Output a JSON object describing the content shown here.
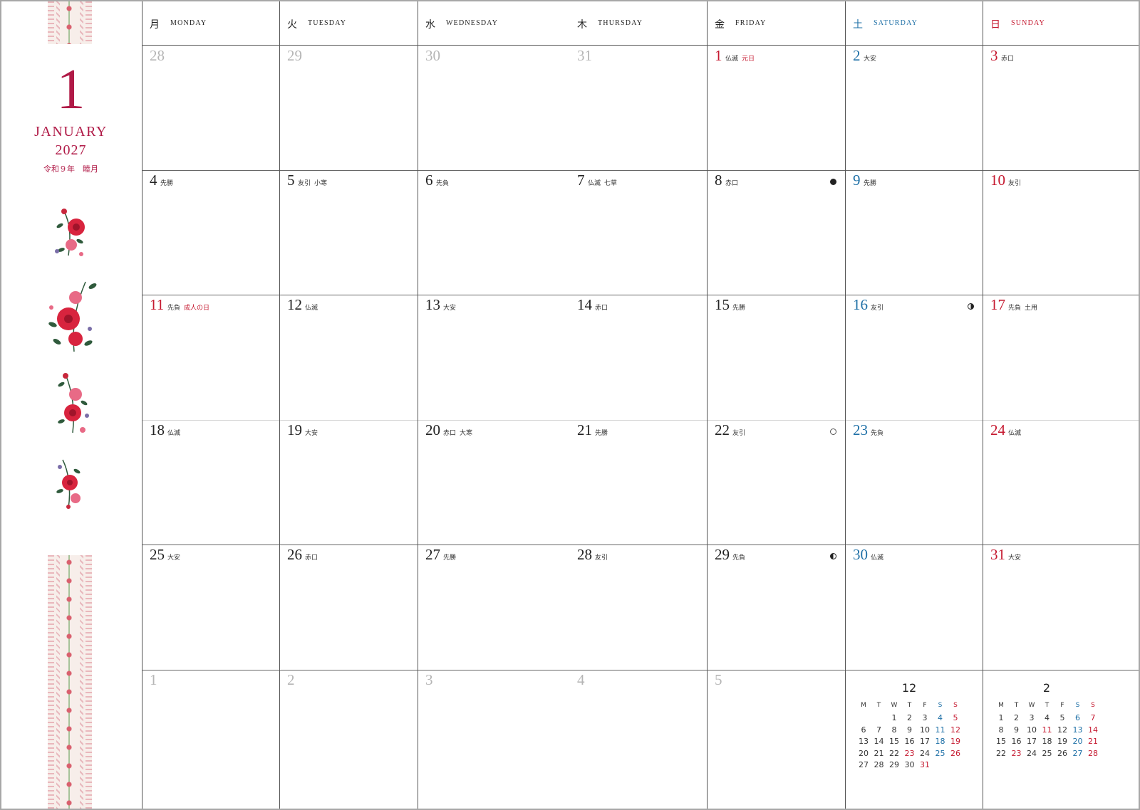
{
  "month": {
    "number": "1",
    "name": "JANUARY",
    "year": "2027",
    "era": "令和９年　睦月"
  },
  "sidebar": {
    "top_ribbon": "ribbon-decoration",
    "flowers": [
      "red-flower-sprig",
      "red-flower-sprig",
      "red-flower-sprig",
      "red-flower-sprig"
    ],
    "bottom_ribbon": "ribbon-decoration"
  },
  "colors": {
    "accent": "#b01a47",
    "saturday": "#1d6fa6",
    "sunday": "#c5182f",
    "muted": "#b5b5b5"
  },
  "headers": [
    {
      "kanji": "月",
      "eng": "MONDAY",
      "type": "weekday"
    },
    {
      "kanji": "火",
      "eng": "TUESDAY",
      "type": "weekday"
    },
    {
      "kanji": "水",
      "eng": "WEDNESDAY",
      "type": "weekday"
    },
    {
      "kanji": "木",
      "eng": "THURSDAY",
      "type": "weekday"
    },
    {
      "kanji": "金",
      "eng": "FRIDAY",
      "type": "weekday"
    },
    {
      "kanji": "土",
      "eng": "SATURDAY",
      "type": "sat"
    },
    {
      "kanji": "日",
      "eng": "SUNDAY",
      "type": "sun"
    }
  ],
  "weeks": [
    [
      {
        "date": "28",
        "style": "muted"
      },
      {
        "date": "29",
        "style": "muted"
      },
      {
        "date": "30",
        "style": "muted"
      },
      {
        "date": "31",
        "style": "muted"
      },
      {
        "date": "1",
        "style": "red",
        "rokuyo": "仏滅",
        "holiday": "元日"
      },
      {
        "date": "2",
        "style": "blue",
        "rokuyo": "大安"
      },
      {
        "date": "3",
        "style": "red",
        "rokuyo": "赤口"
      }
    ],
    [
      {
        "date": "4",
        "style": "normal",
        "rokuyo": "先勝"
      },
      {
        "date": "5",
        "style": "normal",
        "rokuyo": "友引",
        "extra": "小寒"
      },
      {
        "date": "6",
        "style": "normal",
        "rokuyo": "先負"
      },
      {
        "date": "7",
        "style": "normal",
        "rokuyo": "仏滅",
        "extra": "七草"
      },
      {
        "date": "8",
        "style": "normal",
        "rokuyo": "赤口",
        "moon": "new"
      },
      {
        "date": "9",
        "style": "blue",
        "rokuyo": "先勝"
      },
      {
        "date": "10",
        "style": "red",
        "rokuyo": "友引"
      }
    ],
    [
      {
        "date": "11",
        "style": "red",
        "rokuyo": "先負",
        "holiday": "成人の日"
      },
      {
        "date": "12",
        "style": "normal",
        "rokuyo": "仏滅"
      },
      {
        "date": "13",
        "style": "normal",
        "rokuyo": "大安"
      },
      {
        "date": "14",
        "style": "normal",
        "rokuyo": "赤口"
      },
      {
        "date": "15",
        "style": "normal",
        "rokuyo": "先勝"
      },
      {
        "date": "16",
        "style": "blue",
        "rokuyo": "友引",
        "moon": "first"
      },
      {
        "date": "17",
        "style": "red",
        "rokuyo": "先負",
        "extra": "土用"
      }
    ],
    [
      {
        "date": "18",
        "style": "normal",
        "rokuyo": "仏滅"
      },
      {
        "date": "19",
        "style": "normal",
        "rokuyo": "大安"
      },
      {
        "date": "20",
        "style": "normal",
        "rokuyo": "赤口",
        "extra": "大寒"
      },
      {
        "date": "21",
        "style": "normal",
        "rokuyo": "先勝"
      },
      {
        "date": "22",
        "style": "normal",
        "rokuyo": "友引",
        "moon": "full"
      },
      {
        "date": "23",
        "style": "blue",
        "rokuyo": "先負"
      },
      {
        "date": "24",
        "style": "red",
        "rokuyo": "仏滅"
      }
    ],
    [
      {
        "date": "25",
        "style": "normal",
        "rokuyo": "大安"
      },
      {
        "date": "26",
        "style": "normal",
        "rokuyo": "赤口"
      },
      {
        "date": "27",
        "style": "normal",
        "rokuyo": "先勝"
      },
      {
        "date": "28",
        "style": "normal",
        "rokuyo": "友引"
      },
      {
        "date": "29",
        "style": "normal",
        "rokuyo": "先負",
        "moon": "last"
      },
      {
        "date": "30",
        "style": "blue",
        "rokuyo": "仏滅"
      },
      {
        "date": "31",
        "style": "red",
        "rokuyo": "大安"
      }
    ],
    [
      {
        "date": "1",
        "style": "muted"
      },
      {
        "date": "2",
        "style": "muted"
      },
      {
        "date": "3",
        "style": "muted"
      },
      {
        "date": "4",
        "style": "muted"
      },
      {
        "date": "5",
        "style": "muted"
      }
    ]
  ],
  "mini_calendars": [
    {
      "title": "12",
      "weekdays": [
        "M",
        "T",
        "W",
        "T",
        "F",
        "S",
        "S"
      ],
      "offset": 2,
      "days": 31,
      "red_days": [
        "23",
        "31"
      ]
    },
    {
      "title": "2",
      "weekdays": [
        "M",
        "T",
        "W",
        "T",
        "F",
        "S",
        "S"
      ],
      "offset": 0,
      "days": 28,
      "red_days": [
        "11",
        "23"
      ]
    }
  ]
}
